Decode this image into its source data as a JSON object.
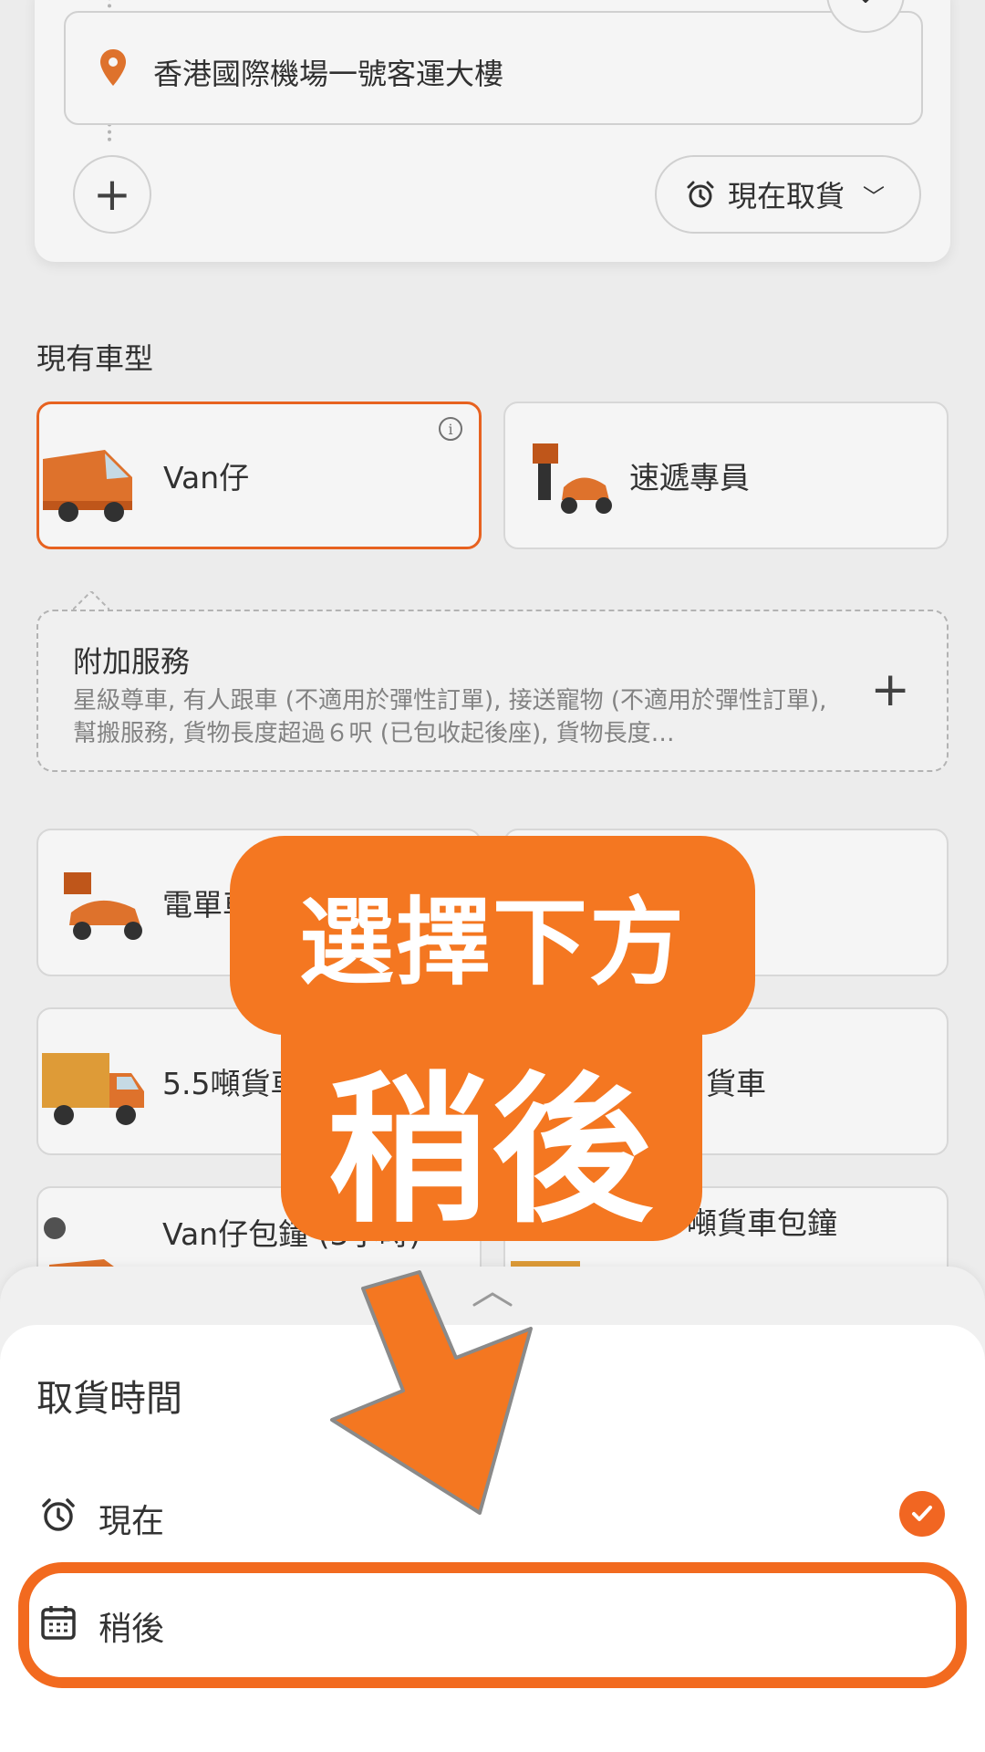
{
  "route": {
    "destination_address": "香港國際機場一號客運大樓",
    "pickup_time_label": "現在取貨"
  },
  "vehicles_section": {
    "title": "現有車型",
    "cards": [
      {
        "name": "Van仔",
        "selected": true
      },
      {
        "name": "速遞專員",
        "selected": false
      },
      {
        "name": "電單車",
        "selected": false
      },
      {
        "name": "",
        "selected": false
      },
      {
        "name": "5.5噸貨車",
        "selected": false
      },
      {
        "name": "貨車",
        "selected": false
      },
      {
        "name": "Van仔包鐘 (3小時)",
        "selected": false
      },
      {
        "name": "5.5 噸貨車包鐘",
        "selected": false
      }
    ]
  },
  "addon": {
    "title": "附加服務",
    "description": "星級尊車, 有人跟車 (不適用於彈性訂單), 接送寵物 (不適用於彈性訂單), 幫搬服務, 貨物長度超過６呎 (已包收起後座), 貨物長度…"
  },
  "pickup_sheet": {
    "title": "取貨時間",
    "options": [
      {
        "label": "現在",
        "icon": "alarm-clock-icon",
        "checked": true
      },
      {
        "label": "稍後",
        "icon": "calendar-icon",
        "checked": false
      }
    ]
  },
  "annotation": {
    "line1": "選擇下方",
    "line2": "稍後"
  },
  "colors": {
    "accent": "#f16622",
    "callout": "#f47721"
  }
}
